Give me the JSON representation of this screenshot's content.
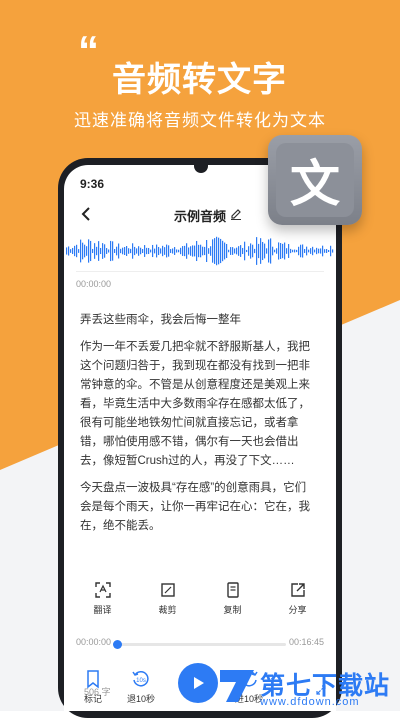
{
  "hero": {
    "quote_mark": "“",
    "title": "音频转文字",
    "subtitle": "迅速准确将音频文件转化为文本"
  },
  "badge": {
    "glyph": "文"
  },
  "status_bar": {
    "time": "9:36"
  },
  "header": {
    "title": "示例音频"
  },
  "audio": {
    "current_time_label": "00:00:00",
    "start_time": "00:00:00",
    "end_time": "00:16:45",
    "progress": 0.02
  },
  "transcript": {
    "paragraphs": [
      "弄丢这些雨伞，我会后悔一整年",
      "作为一年不丢爱几把伞就不舒服斯基人，我把这个问题归咎于，我到现在都没有找到一把非常钟意的伞。不管是从创意程度还是美观上来看，毕竟生活中大多数雨伞存在感都太低了，很有可能坐地铁匆忙间就直接忘记，或者拿错，哪怕使用感不错，偶尔有一天也会借出去，像短暂Crush过的人，再没了下文……",
      "今天盘点一波极具“存在感”的创意雨具，它们会是每个雨天，让你一再牢记在心：它在，我在，绝不能丢。"
    ],
    "word_count": "506 字"
  },
  "actions": [
    {
      "label": "翻译",
      "icon": "translate-icon"
    },
    {
      "label": "裁剪",
      "icon": "crop-icon"
    },
    {
      "label": "复制",
      "icon": "copy-icon"
    },
    {
      "label": "分享",
      "icon": "share-icon"
    }
  ],
  "player": {
    "mark_label": "标记",
    "rewind_label": "退10秒",
    "rewind_badge": "10s",
    "forward_label": "进10秒"
  },
  "watermark": {
    "text": "第七下载站",
    "url": "www.dfdown.com"
  },
  "colors": {
    "accent": "#2d7bf4",
    "hero_bg": "#f5a23d"
  }
}
